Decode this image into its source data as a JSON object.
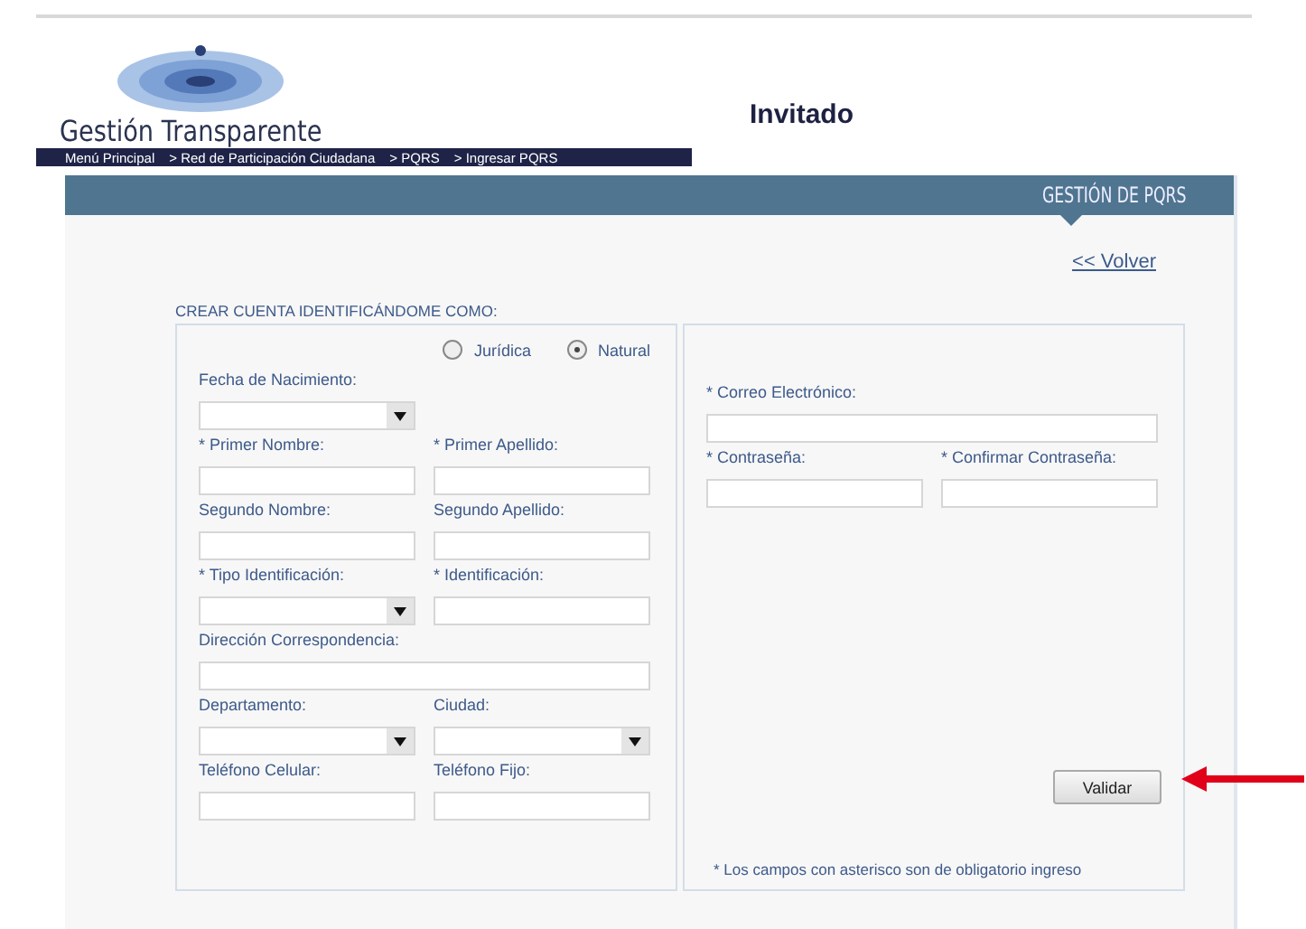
{
  "brand": "Gestión Transparente",
  "user": "Invitado",
  "breadcrumb": [
    "Menú Principal",
    "> Red de Participación Ciudadana",
    "> PQRS",
    "> Ingresar PQRS"
  ],
  "panel": {
    "title": "GESTIÓN DE PQRS",
    "back_link": "<< Volver",
    "section_label": "CREAR CUENTA IDENTIFICÁNDOME COMO:"
  },
  "person_type": [
    {
      "label": "Jurídica",
      "selected": false
    },
    {
      "label": "Natural",
      "selected": true
    }
  ],
  "left_fields": [
    {
      "label": "Fecha de Nacimiento:",
      "kind": "select"
    },
    {
      "kind": "blank"
    },
    {
      "label": "* Primer Nombre:",
      "kind": "text"
    },
    {
      "label": "* Primer Apellido:",
      "kind": "text"
    },
    {
      "label": "Segundo Nombre:",
      "kind": "text"
    },
    {
      "label": "Segundo Apellido:",
      "kind": "text"
    },
    {
      "label": "* Tipo Identificación:",
      "kind": "select"
    },
    {
      "label": "* Identificación:",
      "kind": "text"
    },
    {
      "label": "Dirección Correspondencia:",
      "kind": "wide"
    },
    {
      "label": "Departamento:",
      "kind": "select"
    },
    {
      "label": "Ciudad:",
      "kind": "select"
    },
    {
      "label": "Teléfono Celular:",
      "kind": "text"
    },
    {
      "label": "Teléfono Fijo:",
      "kind": "text"
    }
  ],
  "right_fields": [
    {
      "label": "* Correo Electrónico:",
      "kind": "wide"
    },
    {
      "label": "* Contraseña:",
      "kind": "text"
    },
    {
      "label": "* Confirmar Contraseña:",
      "kind": "text"
    }
  ],
  "submit_button": "Validar",
  "footnote": "* Los campos con asterisco son de obligatorio ingreso"
}
